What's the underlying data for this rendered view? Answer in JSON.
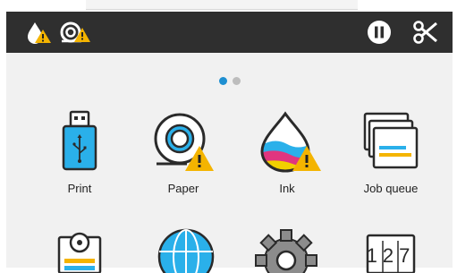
{
  "status_bar": {
    "background": "#2f2f2f",
    "left_icons": [
      "ink-warning-icon",
      "paper-warning-icon"
    ],
    "right_icons": [
      "pause-icon",
      "cut-icon"
    ]
  },
  "pager": {
    "page_count": 2,
    "active_page": 1,
    "active_color": "#1e8fd1"
  },
  "apps": [
    {
      "label": "Print",
      "icon": "usb-drive-icon"
    },
    {
      "label": "Paper",
      "icon": "paper-roll-icon",
      "warning": true
    },
    {
      "label": "Ink",
      "icon": "ink-drop-icon",
      "warning": true
    },
    {
      "label": "Job queue",
      "icon": "job-queue-icon"
    }
  ],
  "second_row_icons": [
    "scan-icon",
    "network-icon",
    "settings-icon",
    "counter-icon"
  ],
  "counter_digits": "127",
  "warning_color": "#f4b400"
}
